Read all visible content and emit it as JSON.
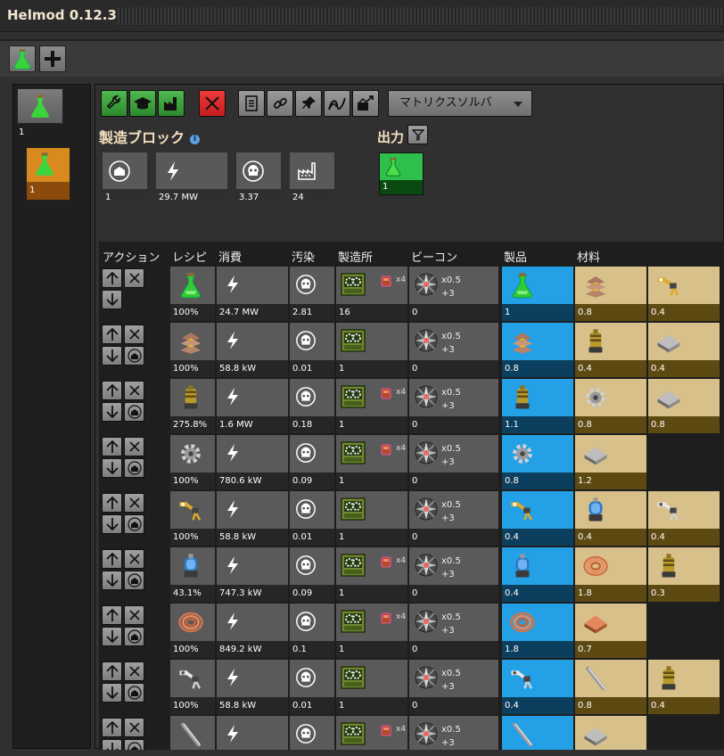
{
  "app_title": "Helmod 0.12.3",
  "toolbar": {
    "solver_label": "マトリクスソルバ"
  },
  "left": {
    "block_count": "1",
    "selected_count": "1"
  },
  "block": {
    "title": "製造ブロック",
    "output_title": "出力",
    "output_value": "1",
    "stats": {
      "buildings": "1",
      "power": "29.7 MW",
      "pollution": "3.37",
      "factories": "24"
    }
  },
  "table": {
    "headers": {
      "action": "アクション",
      "recipe": "レシピ",
      "energy": "消費",
      "pollution": "汚染",
      "factory": "製造所",
      "beacon": "ビーコン",
      "products": "製品",
      "ingredients": "材料"
    },
    "factory_mod": "x4",
    "beacon_speed": "x0.5",
    "beacon_count": "+3",
    "rows": [
      {
        "icon": "science-pack-flask-icon",
        "ratio": "100%",
        "energy": "24.7 MW",
        "pollution": "2.81",
        "factory_count": "16",
        "beacon_count": "0",
        "has_mod": true,
        "products": [
          {
            "icon": "science-pack-flask-icon",
            "value": "1"
          }
        ],
        "ingredients": [
          {
            "icon": "piston-stack-icon",
            "value": "0.8"
          },
          {
            "icon": "inserter-arm-icon",
            "value": "0.4"
          }
        ]
      },
      {
        "icon": "piston-stack-icon",
        "ratio": "100%",
        "energy": "58.8 kW",
        "pollution": "0.01",
        "factory_count": "1",
        "beacon_count": "0",
        "has_mod": false,
        "products": [
          {
            "icon": "piston-stack-icon",
            "value": "0.8"
          }
        ],
        "ingredients": [
          {
            "icon": "motor-icon",
            "value": "0.4"
          },
          {
            "icon": "steel-plate-icon",
            "value": "0.4"
          }
        ]
      },
      {
        "icon": "motor-icon",
        "ratio": "275.8%",
        "energy": "1.6 MW",
        "pollution": "0.18",
        "factory_count": "1",
        "beacon_count": "0",
        "has_mod": true,
        "products": [
          {
            "icon": "motor-icon",
            "value": "1.1"
          }
        ],
        "ingredients": [
          {
            "icon": "gear-icon",
            "value": "0.8"
          },
          {
            "icon": "steel-plate-icon",
            "value": "0.8"
          }
        ]
      },
      {
        "icon": "gear-icon",
        "ratio": "100%",
        "energy": "780.6 kW",
        "pollution": "0.09",
        "factory_count": "1",
        "beacon_count": "0",
        "has_mod": true,
        "products": [
          {
            "icon": "gear-icon",
            "value": "0.8"
          }
        ],
        "ingredients": [
          {
            "icon": "steel-plate-icon",
            "value": "1.2"
          }
        ]
      },
      {
        "icon": "inserter-arm-icon",
        "ratio": "100%",
        "energy": "58.8 kW",
        "pollution": "0.01",
        "factory_count": "1",
        "beacon_count": "0",
        "has_mod": false,
        "products": [
          {
            "icon": "inserter-arm-icon",
            "value": "0.4"
          }
        ],
        "ingredients": [
          {
            "icon": "electric-motor-icon",
            "value": "0.4"
          },
          {
            "icon": "inserter-frame-icon",
            "value": "0.4"
          }
        ]
      },
      {
        "icon": "electric-motor-icon",
        "ratio": "43.1%",
        "energy": "747.3 kW",
        "pollution": "0.09",
        "factory_count": "1",
        "beacon_count": "0",
        "has_mod": true,
        "products": [
          {
            "icon": "electric-motor-icon",
            "value": "0.4"
          }
        ],
        "ingredients": [
          {
            "icon": "copper-coil-icon",
            "value": "1.8"
          },
          {
            "icon": "motor-icon",
            "value": "0.3"
          }
        ]
      },
      {
        "icon": "copper-coil-icon",
        "ratio": "100%",
        "energy": "849.2 kW",
        "pollution": "0.1",
        "factory_count": "1",
        "beacon_count": "0",
        "has_mod": true,
        "products": [
          {
            "icon": "copper-coil-icon",
            "value": "1.8"
          }
        ],
        "ingredients": [
          {
            "icon": "copper-plate-icon",
            "value": "0.7"
          }
        ]
      },
      {
        "icon": "inserter-frame-icon",
        "ratio": "100%",
        "energy": "58.8 kW",
        "pollution": "0.01",
        "factory_count": "1",
        "beacon_count": "0",
        "has_mod": false,
        "products": [
          {
            "icon": "inserter-frame-icon",
            "value": "0.4"
          }
        ],
        "ingredients": [
          {
            "icon": "steel-rod-icon",
            "value": "0.8"
          },
          {
            "icon": "motor-icon",
            "value": "0.4"
          }
        ]
      },
      {
        "icon": "steel-rod-icon",
        "ratio": "",
        "energy": "",
        "pollution": "",
        "factory_count": "",
        "beacon_count": "",
        "has_mod": true,
        "products": [
          {
            "icon": "steel-rod-icon",
            "value": ""
          }
        ],
        "ingredients": [
          {
            "icon": "steel-plate-icon",
            "value": ""
          }
        ]
      }
    ]
  }
}
